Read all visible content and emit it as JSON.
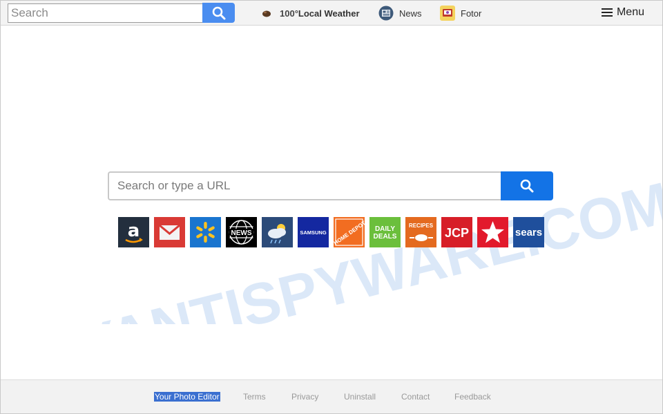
{
  "topbar": {
    "search_placeholder": "Search",
    "links": [
      {
        "pre": "100°",
        "label": "Local Weather",
        "icon": "weather-icon"
      },
      {
        "label": "News",
        "icon": "news-icon"
      },
      {
        "label": "Fotor",
        "icon": "fotor-icon"
      }
    ],
    "menu_label": "Menu"
  },
  "watermark_text": "MYANTISPYWARE.COM",
  "center": {
    "search_placeholder": "Search or type a URL"
  },
  "tiles": [
    {
      "name": "amazon",
      "label": "a",
      "color": "#232f3e"
    },
    {
      "name": "gmail",
      "color": "#d93a35"
    },
    {
      "name": "walmart",
      "color": "#1a75cf"
    },
    {
      "name": "news",
      "label": "NEWS",
      "color": "#000000"
    },
    {
      "name": "weather",
      "color": "#2c4b79"
    },
    {
      "name": "samsung",
      "label": "SAMSUNG",
      "color": "#1428a0"
    },
    {
      "name": "home-depot",
      "label": "HOME DEPOT",
      "color": "#f26d21"
    },
    {
      "name": "daily-deals",
      "label_top": "DAILY",
      "label_bottom": "DEALS",
      "color": "#6bbf3c"
    },
    {
      "name": "recipes",
      "label": "RECIPES",
      "color": "#e46a1f"
    },
    {
      "name": "jcp",
      "label": "JCP",
      "color": "#d71e28"
    },
    {
      "name": "macys",
      "color": "#e21a2c"
    },
    {
      "name": "sears",
      "label": "sears",
      "color": "#1f4f9c"
    }
  ],
  "footer": {
    "links": [
      "Your Photo Editor",
      "Terms",
      "Privacy",
      "Uninstall",
      "Contact",
      "Feedback"
    ]
  }
}
